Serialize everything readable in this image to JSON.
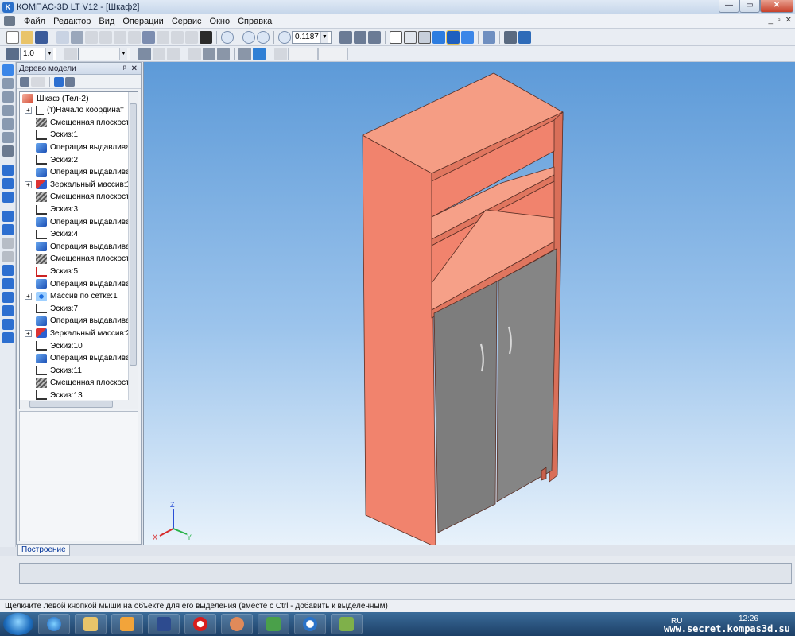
{
  "window": {
    "title": "КОМПАС-3D LT V12 - [Шкаф2]",
    "controls": {
      "minimize": "—",
      "maximize": "▭",
      "close": "✕"
    },
    "mdi_controls": {
      "minimize": "_",
      "restore": "▫",
      "close": "✕"
    }
  },
  "menu": [
    "Файл",
    "Редактор",
    "Вид",
    "Операции",
    "Сервис",
    "Окно",
    "Справка"
  ],
  "toolbar1": {
    "zoom_value": "0.1187"
  },
  "toolbar2": {
    "step_value": "1.0"
  },
  "tree": {
    "title": "Дерево модели",
    "pin": "ᵖ",
    "close": "✕",
    "root": "Шкаф (Тел-2)",
    "items": [
      {
        "label": "(т)Начало координат",
        "icon": "origin-icon",
        "expandable": true
      },
      {
        "label": "Смещенная плоскость",
        "icon": "plane-icon",
        "expandable": false
      },
      {
        "label": "Эскиз:1",
        "icon": "sketch-icon",
        "expandable": false
      },
      {
        "label": "Операция выдавливания",
        "icon": "extrude-icon",
        "expandable": false
      },
      {
        "label": "Эскиз:2",
        "icon": "sketch-icon",
        "expandable": false
      },
      {
        "label": "Операция выдавливания",
        "icon": "extrude-icon",
        "expandable": false
      },
      {
        "label": "Зеркальный массив:1",
        "icon": "mirror-array-icon",
        "expandable": true
      },
      {
        "label": "Смещенная плоскость",
        "icon": "plane-icon",
        "expandable": false
      },
      {
        "label": "Эскиз:3",
        "icon": "sketch-icon",
        "expandable": false
      },
      {
        "label": "Операция выдавливания",
        "icon": "extrude-icon",
        "expandable": false
      },
      {
        "label": "Эскиз:4",
        "icon": "sketch-icon",
        "expandable": false
      },
      {
        "label": "Операция выдавливания",
        "icon": "extrude-icon",
        "expandable": false
      },
      {
        "label": "Смещенная плоскость",
        "icon": "plane-icon",
        "expandable": false
      },
      {
        "label": "Эскиз:5",
        "icon": "sketch-error-icon",
        "expandable": false
      },
      {
        "label": "Операция выдавливания",
        "icon": "extrude-icon",
        "expandable": false
      },
      {
        "label": "Массив по сетке:1",
        "icon": "grid-array-icon",
        "expandable": true
      },
      {
        "label": "Эскиз:7",
        "icon": "sketch-icon",
        "expandable": false
      },
      {
        "label": "Операция выдавливания",
        "icon": "extrude-icon",
        "expandable": false
      },
      {
        "label": "Зеркальный массив:2",
        "icon": "mirror-array-icon",
        "expandable": true
      },
      {
        "label": "Эскиз:10",
        "icon": "sketch-icon",
        "expandable": false
      },
      {
        "label": "Операция выдавливания",
        "icon": "extrude-icon",
        "expandable": false
      },
      {
        "label": "Эскиз:11",
        "icon": "sketch-icon",
        "expandable": false
      },
      {
        "label": "Смещенная плоскость",
        "icon": "plane-icon",
        "expandable": false
      },
      {
        "label": "Эскиз:13",
        "icon": "sketch-icon",
        "expandable": false
      }
    ]
  },
  "axes": {
    "x": "X",
    "y": "Y",
    "z": "Z"
  },
  "bottom_tab": "Построение",
  "status": "Щелкните левой кнопкой мыши на объекте для его выделения (вместе с Ctrl - добавить к выделенным)",
  "taskbar": {
    "lang": "RU",
    "time": "12:26",
    "watermark": "www.secret.kompas3d.su"
  },
  "colors": {
    "cabinet_side": "#f08570",
    "cabinet_front": "#f28a74",
    "cabinet_top": "#f49a82",
    "door": "#808080",
    "viewport_top": "#5d9ad8"
  }
}
